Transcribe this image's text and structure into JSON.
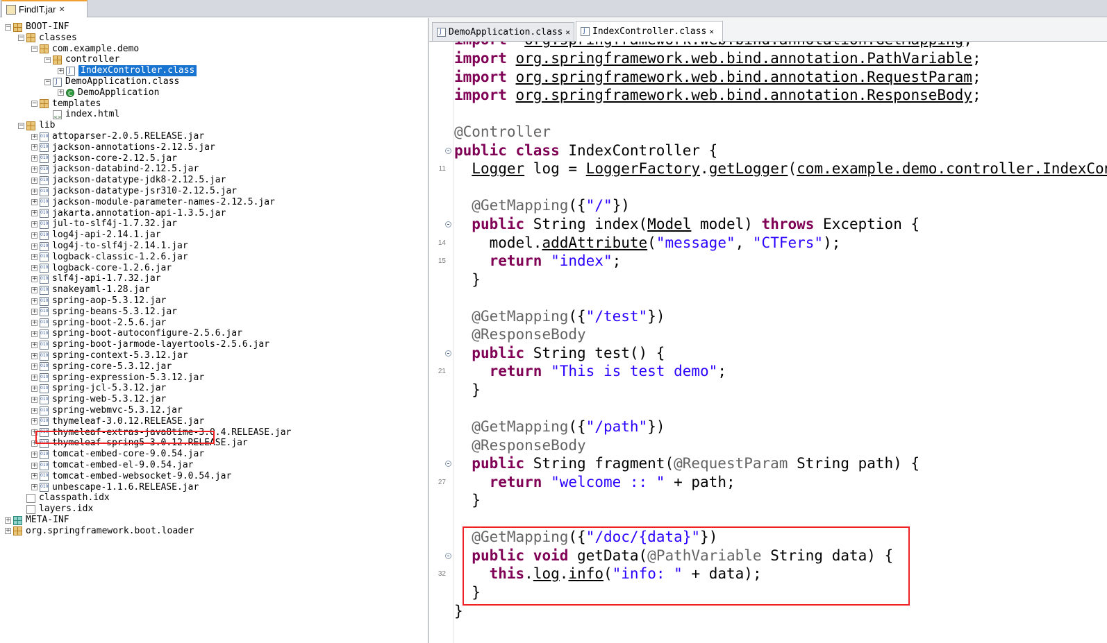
{
  "window_tab": {
    "label": "FindIT.jar"
  },
  "tree": [
    {
      "label": "BOOT-INF",
      "indent": 0,
      "icon": "package-icon",
      "toggle": "-"
    },
    {
      "label": "classes",
      "indent": 1,
      "icon": "package-icon",
      "toggle": "-"
    },
    {
      "label": "com.example.demo",
      "indent": 2,
      "icon": "package-icon",
      "toggle": "-"
    },
    {
      "label": "controller",
      "indent": 3,
      "icon": "package-icon",
      "toggle": "-"
    },
    {
      "label": "IndexController.class",
      "indent": 4,
      "icon": "class-file-icon",
      "toggle": "+",
      "selected": true
    },
    {
      "label": "DemoApplication.class",
      "indent": 3,
      "icon": "class-file-icon",
      "toggle": "-"
    },
    {
      "label": "DemoApplication",
      "indent": 4,
      "icon": "class-icon",
      "toggle": "+"
    },
    {
      "label": "templates",
      "indent": 2,
      "icon": "package-icon",
      "toggle": "-"
    },
    {
      "label": "index.html",
      "indent": 3,
      "icon": "html-file-icon",
      "toggle": ""
    },
    {
      "label": "lib",
      "indent": 1,
      "icon": "package-icon",
      "toggle": "-"
    },
    {
      "label": "attoparser-2.0.5.RELEASE.jar",
      "indent": 2,
      "icon": "jar-icon",
      "toggle": "+"
    },
    {
      "label": "jackson-annotations-2.12.5.jar",
      "indent": 2,
      "icon": "jar-icon",
      "toggle": "+"
    },
    {
      "label": "jackson-core-2.12.5.jar",
      "indent": 2,
      "icon": "jar-icon",
      "toggle": "+"
    },
    {
      "label": "jackson-databind-2.12.5.jar",
      "indent": 2,
      "icon": "jar-icon",
      "toggle": "+"
    },
    {
      "label": "jackson-datatype-jdk8-2.12.5.jar",
      "indent": 2,
      "icon": "jar-icon",
      "toggle": "+"
    },
    {
      "label": "jackson-datatype-jsr310-2.12.5.jar",
      "indent": 2,
      "icon": "jar-icon",
      "toggle": "+"
    },
    {
      "label": "jackson-module-parameter-names-2.12.5.jar",
      "indent": 2,
      "icon": "jar-icon",
      "toggle": "+"
    },
    {
      "label": "jakarta.annotation-api-1.3.5.jar",
      "indent": 2,
      "icon": "jar-icon",
      "toggle": "+"
    },
    {
      "label": "jul-to-slf4j-1.7.32.jar",
      "indent": 2,
      "icon": "jar-icon",
      "toggle": "+"
    },
    {
      "label": "log4j-api-2.14.1.jar",
      "indent": 2,
      "icon": "jar-icon",
      "toggle": "+"
    },
    {
      "label": "log4j-to-slf4j-2.14.1.jar",
      "indent": 2,
      "icon": "jar-icon",
      "toggle": "+"
    },
    {
      "label": "logback-classic-1.2.6.jar",
      "indent": 2,
      "icon": "jar-icon",
      "toggle": "+"
    },
    {
      "label": "logback-core-1.2.6.jar",
      "indent": 2,
      "icon": "jar-icon",
      "toggle": "+"
    },
    {
      "label": "slf4j-api-1.7.32.jar",
      "indent": 2,
      "icon": "jar-icon",
      "toggle": "+"
    },
    {
      "label": "snakeyaml-1.28.jar",
      "indent": 2,
      "icon": "jar-icon",
      "toggle": "+"
    },
    {
      "label": "spring-aop-5.3.12.jar",
      "indent": 2,
      "icon": "jar-icon",
      "toggle": "+"
    },
    {
      "label": "spring-beans-5.3.12.jar",
      "indent": 2,
      "icon": "jar-icon",
      "toggle": "+"
    },
    {
      "label": "spring-boot-2.5.6.jar",
      "indent": 2,
      "icon": "jar-icon",
      "toggle": "+"
    },
    {
      "label": "spring-boot-autoconfigure-2.5.6.jar",
      "indent": 2,
      "icon": "jar-icon",
      "toggle": "+"
    },
    {
      "label": "spring-boot-jarmode-layertools-2.5.6.jar",
      "indent": 2,
      "icon": "jar-icon",
      "toggle": "+"
    },
    {
      "label": "spring-context-5.3.12.jar",
      "indent": 2,
      "icon": "jar-icon",
      "toggle": "+"
    },
    {
      "label": "spring-core-5.3.12.jar",
      "indent": 2,
      "icon": "jar-icon",
      "toggle": "+"
    },
    {
      "label": "spring-expression-5.3.12.jar",
      "indent": 2,
      "icon": "jar-icon",
      "toggle": "+"
    },
    {
      "label": "spring-jcl-5.3.12.jar",
      "indent": 2,
      "icon": "jar-icon",
      "toggle": "+"
    },
    {
      "label": "spring-web-5.3.12.jar",
      "indent": 2,
      "icon": "jar-icon",
      "toggle": "+"
    },
    {
      "label": "spring-webmvc-5.3.12.jar",
      "indent": 2,
      "icon": "jar-icon",
      "toggle": "+"
    },
    {
      "label": "thymeleaf-3.0.12.RELEASE.jar",
      "indent": 2,
      "icon": "jar-icon",
      "toggle": "+",
      "highlighted": true
    },
    {
      "label": "thymeleaf-extras-java8time-3.0.4.RELEASE.jar",
      "indent": 2,
      "icon": "jar-icon",
      "toggle": "+"
    },
    {
      "label": "thymeleaf-spring5-3.0.12.RELEASE.jar",
      "indent": 2,
      "icon": "jar-icon",
      "toggle": "+"
    },
    {
      "label": "tomcat-embed-core-9.0.54.jar",
      "indent": 2,
      "icon": "jar-icon",
      "toggle": "+"
    },
    {
      "label": "tomcat-embed-el-9.0.54.jar",
      "indent": 2,
      "icon": "jar-icon",
      "toggle": "+"
    },
    {
      "label": "tomcat-embed-websocket-9.0.54.jar",
      "indent": 2,
      "icon": "jar-icon",
      "toggle": "+"
    },
    {
      "label": "unbescape-1.1.6.RELEASE.jar",
      "indent": 2,
      "icon": "jar-icon",
      "toggle": "+"
    },
    {
      "label": "classpath.idx",
      "indent": 1,
      "icon": "file-icon",
      "toggle": ""
    },
    {
      "label": "layers.idx",
      "indent": 1,
      "icon": "file-icon",
      "toggle": ""
    },
    {
      "label": "META-INF",
      "indent": 0,
      "icon": "meta-package-icon",
      "toggle": "+"
    },
    {
      "label": "org.springframework.boot.loader",
      "indent": 0,
      "icon": "package-icon",
      "toggle": "+"
    }
  ],
  "editor_tabs": [
    {
      "label": "DemoApplication.class",
      "active": false
    },
    {
      "label": "IndexController.class",
      "active": true
    }
  ],
  "code_lines": [
    {
      "row": -1,
      "num": "",
      "fold": false,
      "tokens": [
        [
          "kw",
          "import"
        ],
        [
          "",
          "  "
        ],
        [
          "ul",
          "org.springframework.web.bind.annotation.GetMapping"
        ],
        [
          "",
          ";"
        ]
      ]
    },
    {
      "row": 0,
      "num": "",
      "fold": false,
      "tokens": [
        [
          "kw",
          "import"
        ],
        [
          "",
          " "
        ],
        [
          "ul",
          "org.springframework.web.bind.annotation.PathVariable"
        ],
        [
          "",
          ";"
        ]
      ]
    },
    {
      "row": 1,
      "num": "",
      "fold": false,
      "tokens": [
        [
          "kw",
          "import"
        ],
        [
          "",
          " "
        ],
        [
          "ul",
          "org.springframework.web.bind.annotation.RequestParam"
        ],
        [
          "",
          ";"
        ]
      ]
    },
    {
      "row": 2,
      "num": "",
      "fold": false,
      "tokens": [
        [
          "kw",
          "import"
        ],
        [
          "",
          " "
        ],
        [
          "ul",
          "org.springframework.web.bind.annotation.ResponseBody"
        ],
        [
          "",
          ";"
        ]
      ]
    },
    {
      "row": 4,
      "num": "",
      "fold": false,
      "tokens": [
        [
          "ann",
          "@Controller"
        ]
      ]
    },
    {
      "row": 5,
      "num": "",
      "fold": true,
      "tokens": [
        [
          "kw",
          "public class"
        ],
        [
          "",
          " IndexController {"
        ]
      ]
    },
    {
      "row": 6,
      "num": "11",
      "fold": false,
      "tokens": [
        [
          "",
          "  "
        ],
        [
          "ul",
          "Logger"
        ],
        [
          "",
          " log = "
        ],
        [
          "ul",
          "LoggerFactory"
        ],
        [
          "",
          "."
        ],
        [
          "ul",
          "getLogger"
        ],
        [
          "",
          "("
        ],
        [
          "ul",
          "com.example.demo.controller.IndexController"
        ]
      ]
    },
    {
      "row": 8,
      "num": "",
      "fold": false,
      "tokens": [
        [
          "",
          "  "
        ],
        [
          "ann",
          "@GetMapping"
        ],
        [
          "",
          "({"
        ],
        [
          "str",
          "\"/\""
        ],
        [
          "",
          "})"
        ]
      ]
    },
    {
      "row": 9,
      "num": "",
      "fold": true,
      "tokens": [
        [
          "",
          "  "
        ],
        [
          "kw",
          "public"
        ],
        [
          "",
          " String index("
        ],
        [
          "ul",
          "Model"
        ],
        [
          "",
          " model) "
        ],
        [
          "kw",
          "throws"
        ],
        [
          "",
          " Exception {"
        ]
      ]
    },
    {
      "row": 10,
      "num": "14",
      "fold": false,
      "tokens": [
        [
          "",
          "    model."
        ],
        [
          "ul",
          "addAttribute"
        ],
        [
          "",
          "("
        ],
        [
          "str",
          "\"message\""
        ],
        [
          "",
          ", "
        ],
        [
          "str",
          "\"CTFers\""
        ],
        [
          "",
          ");"
        ]
      ]
    },
    {
      "row": 11,
      "num": "15",
      "fold": false,
      "tokens": [
        [
          "",
          "    "
        ],
        [
          "kw",
          "return"
        ],
        [
          "",
          " "
        ],
        [
          "str",
          "\"index\""
        ],
        [
          "",
          ";"
        ]
      ]
    },
    {
      "row": 12,
      "num": "",
      "fold": false,
      "tokens": [
        [
          "",
          "  }"
        ]
      ]
    },
    {
      "row": 14,
      "num": "",
      "fold": false,
      "tokens": [
        [
          "",
          "  "
        ],
        [
          "ann",
          "@GetMapping"
        ],
        [
          "",
          "({"
        ],
        [
          "str",
          "\"/test\""
        ],
        [
          "",
          "})"
        ]
      ]
    },
    {
      "row": 15,
      "num": "",
      "fold": false,
      "tokens": [
        [
          "",
          "  "
        ],
        [
          "ann",
          "@ResponseBody"
        ]
      ]
    },
    {
      "row": 16,
      "num": "",
      "fold": true,
      "tokens": [
        [
          "",
          "  "
        ],
        [
          "kw",
          "public"
        ],
        [
          "",
          " String test() {"
        ]
      ]
    },
    {
      "row": 17,
      "num": "21",
      "fold": false,
      "tokens": [
        [
          "",
          "    "
        ],
        [
          "kw",
          "return"
        ],
        [
          "",
          " "
        ],
        [
          "str",
          "\"This is test demo\""
        ],
        [
          "",
          ";"
        ]
      ]
    },
    {
      "row": 18,
      "num": "",
      "fold": false,
      "tokens": [
        [
          "",
          "  }"
        ]
      ]
    },
    {
      "row": 20,
      "num": "",
      "fold": false,
      "tokens": [
        [
          "",
          "  "
        ],
        [
          "ann",
          "@GetMapping"
        ],
        [
          "",
          "({"
        ],
        [
          "str",
          "\"/path\""
        ],
        [
          "",
          "})"
        ]
      ]
    },
    {
      "row": 21,
      "num": "",
      "fold": false,
      "tokens": [
        [
          "",
          "  "
        ],
        [
          "ann",
          "@ResponseBody"
        ]
      ]
    },
    {
      "row": 22,
      "num": "",
      "fold": true,
      "tokens": [
        [
          "",
          "  "
        ],
        [
          "kw",
          "public"
        ],
        [
          "",
          " String fragment("
        ],
        [
          "ann",
          "@RequestParam"
        ],
        [
          "",
          " String path) {"
        ]
      ]
    },
    {
      "row": 23,
      "num": "27",
      "fold": false,
      "tokens": [
        [
          "",
          "    "
        ],
        [
          "kw",
          "return"
        ],
        [
          "",
          " "
        ],
        [
          "str",
          "\"welcome :: \""
        ],
        [
          "",
          " + path;"
        ]
      ]
    },
    {
      "row": 24,
      "num": "",
      "fold": false,
      "tokens": [
        [
          "",
          "  }"
        ]
      ]
    },
    {
      "row": 26,
      "num": "",
      "fold": false,
      "tokens": [
        [
          "",
          "  "
        ],
        [
          "ann",
          "@GetMapping"
        ],
        [
          "",
          "({"
        ],
        [
          "str",
          "\"/doc/{data}\""
        ],
        [
          "",
          "})"
        ]
      ]
    },
    {
      "row": 27,
      "num": "",
      "fold": true,
      "tokens": [
        [
          "",
          "  "
        ],
        [
          "kw",
          "public void"
        ],
        [
          "",
          " getData("
        ],
        [
          "ann",
          "@PathVariable"
        ],
        [
          "",
          " String data) {"
        ]
      ]
    },
    {
      "row": 28,
      "num": "32",
      "fold": false,
      "tokens": [
        [
          "",
          "    "
        ],
        [
          "kw",
          "this"
        ],
        [
          "",
          "."
        ],
        [
          "ul",
          "log"
        ],
        [
          "",
          "."
        ],
        [
          "ul",
          "info"
        ],
        [
          "",
          "("
        ],
        [
          "str",
          "\"info: \""
        ],
        [
          "",
          " + data);"
        ]
      ]
    },
    {
      "row": 29,
      "num": "",
      "fold": false,
      "tokens": [
        [
          "",
          "  }"
        ]
      ]
    },
    {
      "row": 30,
      "num": "",
      "fold": false,
      "tokens": [
        [
          "",
          "}"
        ]
      ]
    }
  ],
  "colors": {
    "keyword": "#7f0055",
    "string": "#2a00ff",
    "annotation": "#646464",
    "selection": "#1874d1",
    "highlight_box": "#e22222"
  }
}
